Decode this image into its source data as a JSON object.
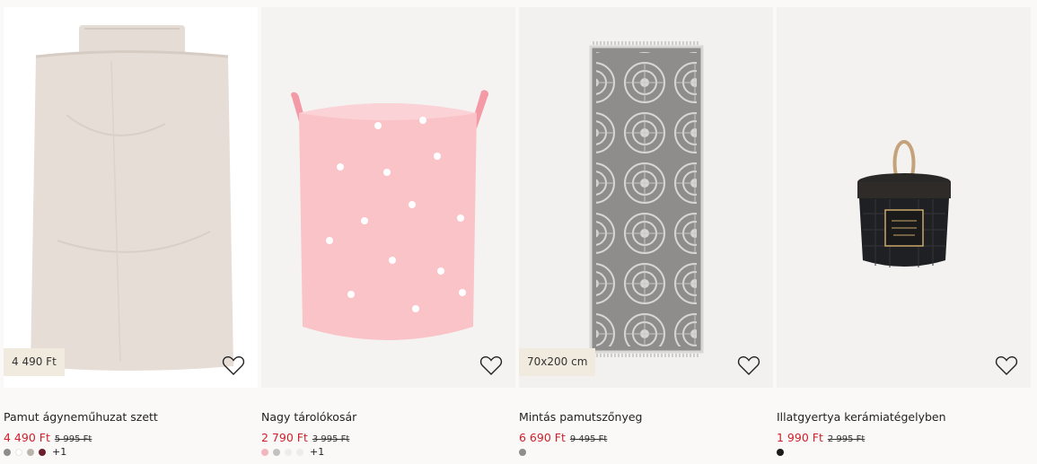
{
  "products": [
    {
      "title": "Pamut ágyneműhuzat szett",
      "price": "4 490 Ft",
      "old_price": "5 995 Ft",
      "tag": "4 490 Ft",
      "swatches": [
        "#8d8d8d",
        "#ffffff",
        "#b9b5ac",
        "#6b1f2c"
      ],
      "more": "+1"
    },
    {
      "title": "Nagy tárolókosár",
      "price": "2 790 Ft",
      "old_price": "3 995 Ft",
      "tag": "",
      "swatches": [
        "#f2b6bf",
        "#c2c2c2",
        "#ececec",
        "#ececec"
      ],
      "more": "+1"
    },
    {
      "title": "Mintás pamutszőnyeg",
      "price": "6 690 Ft",
      "old_price": "9 495 Ft",
      "tag": "70x200 cm",
      "swatches": [
        "#8e8e8e"
      ],
      "more": ""
    },
    {
      "title": "Illatgyertya kerámiatégelyben",
      "price": "1 990 Ft",
      "old_price": "2 995 Ft",
      "tag": "",
      "swatches": [
        "#1b1b1b"
      ],
      "more": ""
    }
  ],
  "icons": {
    "favorite": "heart-outline-icon"
  },
  "colors": {
    "sale_price": "#d0202a",
    "tag_bg": "#f1ebdf",
    "page_bg": "#faf9f8"
  }
}
